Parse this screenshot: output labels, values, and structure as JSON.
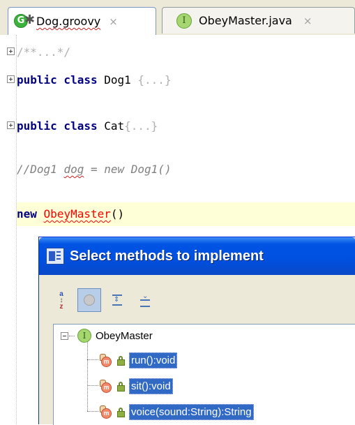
{
  "tabs": [
    {
      "label": "Dog.groovy",
      "close": "×",
      "icon": "groovy-file-icon"
    },
    {
      "label": "ObeyMaster.java",
      "close": "×",
      "icon": "interface-icon",
      "icon_glyph": "I"
    }
  ],
  "code": {
    "line1": "/**...*/",
    "line2_kw": "public class",
    "line2_name": "Dog1",
    "line2_fold": "{...}",
    "line3_kw": "public class",
    "line3_name": "Cat",
    "line3_fold": "{...}",
    "comment_prefix": "//Dog1 ",
    "comment_dog": "dog",
    "comment_suffix": " = new Dog1()",
    "new_kw": "new",
    "new_class": "ObeyMaster",
    "new_parens": "()"
  },
  "dialog": {
    "title": "Select methods to implement",
    "root": "ObeyMaster",
    "root_glyph": "I",
    "methods": [
      "run():void",
      "sit():void",
      "voice(sound:String):String"
    ]
  },
  "colors": {
    "keyword": "#000080",
    "error": "#ff0000",
    "comment": "#808080",
    "current_line": "#ffffd7",
    "selection": "#316ac5",
    "titlebar": "#0054e3"
  }
}
